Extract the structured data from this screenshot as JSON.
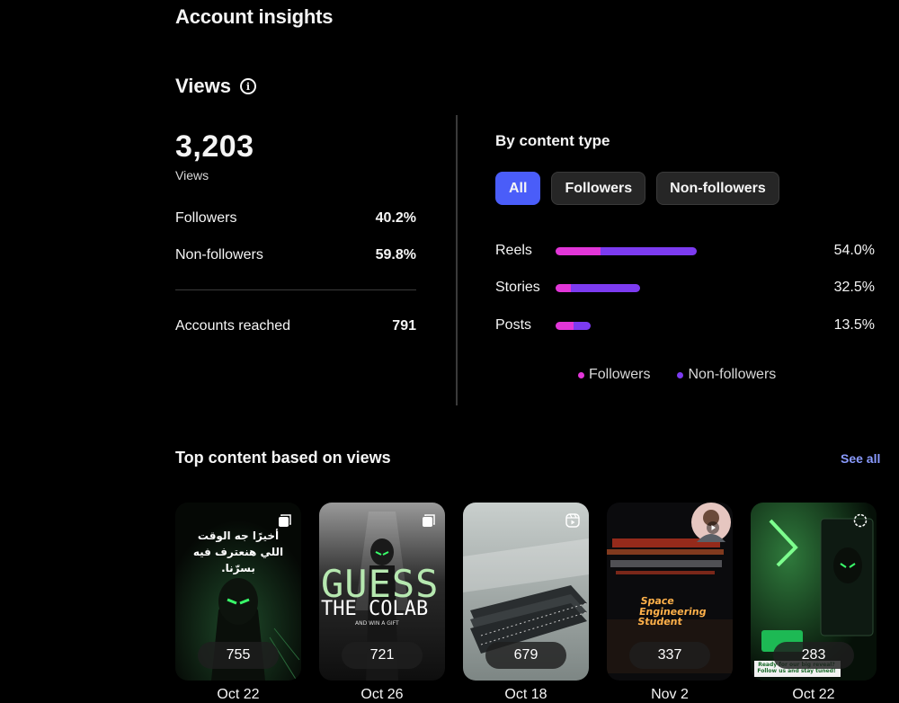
{
  "page": {
    "title": "Account insights"
  },
  "views": {
    "heading": "Views",
    "total": "3,203",
    "total_label": "Views",
    "followers_label": "Followers",
    "followers_pct": "40.2%",
    "nonfollowers_label": "Non-followers",
    "nonfollowers_pct": "59.8%",
    "accounts_reached_label": "Accounts reached",
    "accounts_reached_value": "791"
  },
  "content_type": {
    "title": "By content type",
    "filters": [
      {
        "label": "All",
        "active": true
      },
      {
        "label": "Followers",
        "active": false
      },
      {
        "label": "Non-followers",
        "active": false
      }
    ],
    "colors": {
      "followers": "#e236d8",
      "non_followers": "#7c3bf0",
      "accent": "#4a5df9"
    },
    "rows": [
      {
        "label": "Reels",
        "pct": "54.0%",
        "share": 0.54,
        "followers_fraction": 0.32
      },
      {
        "label": "Stories",
        "pct": "32.5%",
        "share": 0.325,
        "followers_fraction": 0.18
      },
      {
        "label": "Posts",
        "pct": "13.5%",
        "share": 0.135,
        "followers_fraction": 0.5
      }
    ],
    "legend": {
      "followers": "Followers",
      "non_followers": "Non-followers"
    }
  },
  "top_content": {
    "title": "Top content based on views",
    "see_all": "See all",
    "items": [
      {
        "views": "755",
        "date": "Oct 22",
        "type_icon": "carousel-icon",
        "overlay_lines": [
          "أخيرًا جه الوقت",
          "اللي هنعترف فيه بسرّنا."
        ]
      },
      {
        "views": "721",
        "date": "Oct 26",
        "type_icon": "carousel-icon",
        "overlay_lines": [
          "GUESS",
          "THE COLAB",
          "AND WIN A GIFT"
        ]
      },
      {
        "views": "679",
        "date": "Oct 18",
        "type_icon": "reel-icon",
        "overlay_lines": []
      },
      {
        "views": "337",
        "date": "Nov 2",
        "type_icon": "video-icon",
        "overlay_lines": [
          "Space",
          "Engineering",
          "Student"
        ]
      },
      {
        "views": "283",
        "date": "Oct 22",
        "type_icon": "story-icon",
        "overlay_lines": [
          "Ready for our big reveal?",
          "Follow us and stay tuned!"
        ]
      }
    ]
  }
}
